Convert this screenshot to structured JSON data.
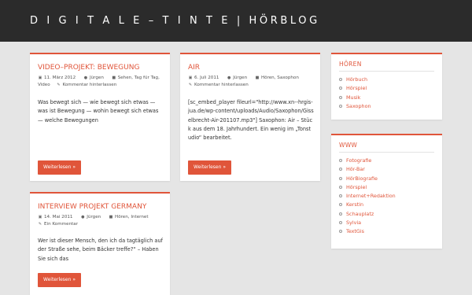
{
  "site": {
    "title": "D I G I T A L E – T I N T E | HÖRBLOG"
  },
  "posts": [
    {
      "title": "VIDEO–PROJEKT: BEWEGUNG",
      "date": "11. März 2012",
      "author": "Jürgen",
      "categories_line1": "Sehen, Tag für Tag,",
      "categories_line2": "Video",
      "comments": "Kommentar hinterlassen",
      "excerpt": "Was bewegt sich — wie bewegt sich etwas — was ist Bewegung — wohin bewegt sich etwas — welche Bewegungen",
      "button": "Weiterlesen »"
    },
    {
      "title": "AIR",
      "date": "6. Juli 2011",
      "author": "Jürgen",
      "categories_line1": "Hören, Saxophon",
      "comments": "Kommentar hinterlassen",
      "excerpt": "[sc_embed_player fileurl=\"http://www.xn--hrgis-jua.de/wp-content/uploads/Audio/Saxophon/Gisselbrecht-Air-201107.mp3\"] Saxophon: Air – Stück aus dem 18. Jahrhundert. Ein wenig im „Tonstudio“ bearbeitet.",
      "button": "Weiterlesen »"
    },
    {
      "title": "INTERVIEW PROJEKT GERMANY",
      "date": "14. Mai 2011",
      "author": "Jürgen",
      "categories_line1": "Hören, Internet",
      "comments": "Ein Kommentar",
      "excerpt": "Wer ist dieser Mensch, den ich da tagtäglich auf der Straße sehe, beim Bäcker treffe?“ – Haben Sie sich das",
      "button": "Weiterlesen »"
    }
  ],
  "widgets": {
    "hoeren": {
      "title": "HÖREN",
      "items": [
        "Hörbuch",
        "Hörspiel",
        "Musik",
        "Saxophon"
      ]
    },
    "www": {
      "title": "WWW",
      "items": [
        "Fotografie",
        "Hör-Bar",
        "HörBiografie",
        "Hörspiel",
        "Internet+Redaktion",
        "Kerstin",
        "Schauplatz",
        "Sylvia",
        "TextGis"
      ]
    }
  },
  "icons": {
    "date": "calendar-icon",
    "author": "user-icon",
    "category": "folder-icon",
    "comment": "pencil-icon"
  },
  "colors": {
    "accent": "#e0553a",
    "header": "#2b2b2b",
    "background": "#e5e5e5"
  }
}
